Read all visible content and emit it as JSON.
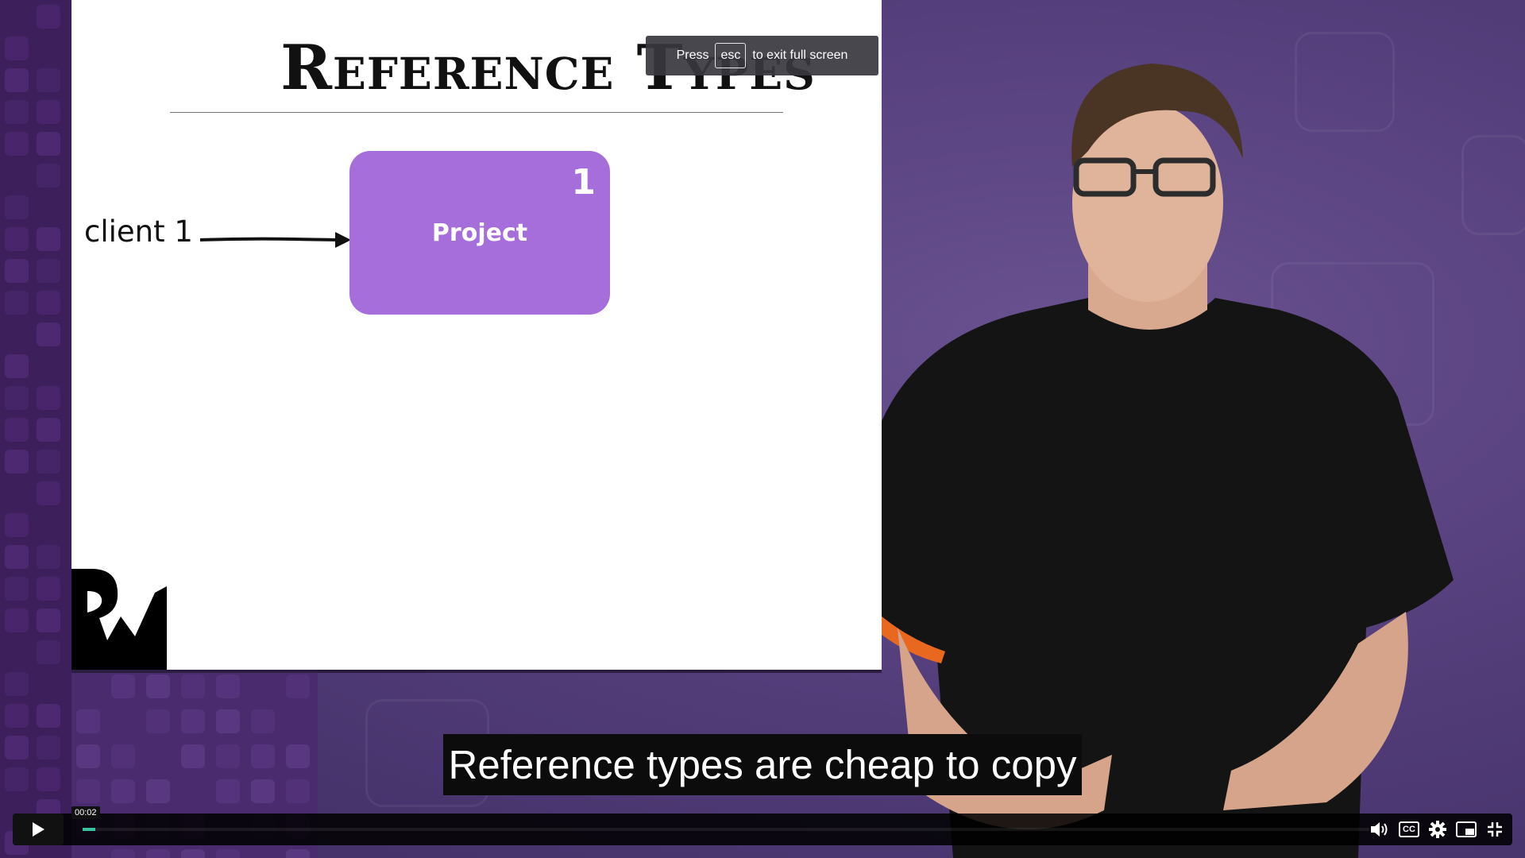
{
  "slide": {
    "title": "Reference Types",
    "box_label": "Project",
    "box_count": "1",
    "client_label": "client 1"
  },
  "fullscreen_hint": {
    "prefix": "Press",
    "key": "esc",
    "suffix": "to exit full screen"
  },
  "caption": "Reference types are cheap to copy",
  "player": {
    "current_time": "00:02",
    "progress_fraction": 0.01,
    "accent_color": "#3cc1a0",
    "controls": [
      "play-icon",
      "volume-icon",
      "closed-captions-icon",
      "settings-gear-icon",
      "picture-in-picture-icon",
      "exit-fullscreen-icon"
    ]
  },
  "colors": {
    "project_box": "#a66edb",
    "background": "#553f7c"
  }
}
